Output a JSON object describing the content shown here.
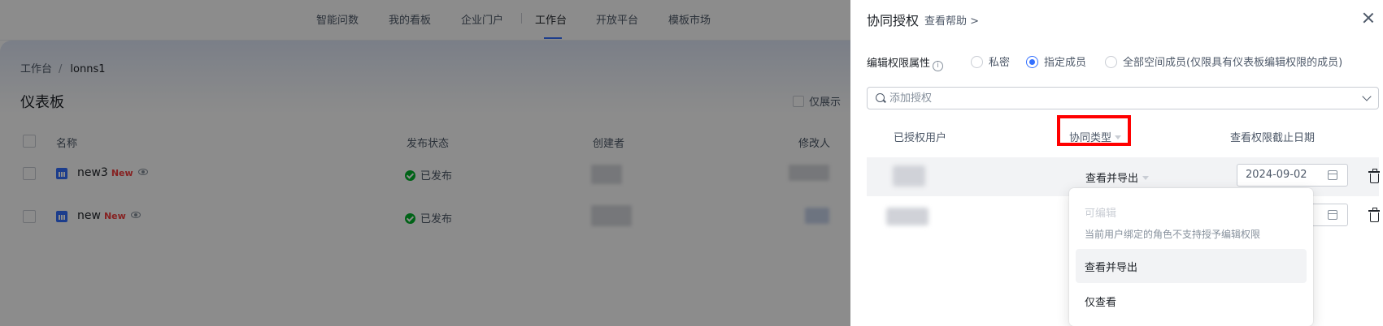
{
  "topnav": {
    "items": [
      "智能问数",
      "我的看板",
      "企业门户",
      "工作台",
      "开放平台",
      "模板市场"
    ],
    "active_index": 3
  },
  "breadcrumb": {
    "root": "工作台",
    "separator": "/",
    "current": "lonns1"
  },
  "page": {
    "title": "仪表板",
    "only_show_label": "仅展示"
  },
  "table": {
    "headers": {
      "name": "名称",
      "status": "发布状态",
      "creator": "创建者",
      "modifier": "修改人"
    },
    "rows": [
      {
        "name": "new3",
        "tag": "New",
        "status": "已发布"
      },
      {
        "name": "new",
        "tag": "New",
        "status": "已发布"
      }
    ]
  },
  "drawer": {
    "title": "协同授权",
    "help_link": "查看帮助 >",
    "edit_perm_label": "编辑权限属性",
    "info_icon": "i",
    "radios": [
      "私密",
      "指定成员",
      "全部空间成员(仅限具有仪表板编辑权限的成员)"
    ],
    "radio_selected": 1,
    "search_placeholder": "添加授权",
    "columns": {
      "user": "已授权用户",
      "type": "协同类型",
      "deadline": "查看权限截止日期"
    },
    "rows": [
      {
        "type": "查看并导出",
        "date": "2024-09-02"
      }
    ]
  },
  "dropdown": {
    "disabled_option": "可编辑",
    "disabled_note": "当前用户绑定的角色不支持授予编辑权限",
    "options": [
      "查看并导出",
      "仅查看"
    ],
    "selected_index": 0
  },
  "colors": {
    "accent": "#3370ff",
    "success": "#00b42a",
    "danger": "#f53f3f",
    "highlight": "#ff0000"
  }
}
